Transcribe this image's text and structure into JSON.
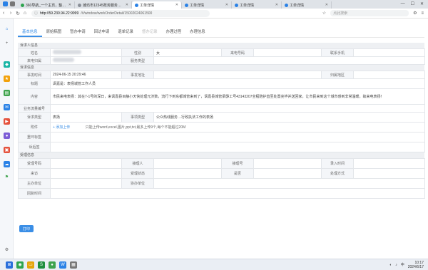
{
  "browser": {
    "tabs": [
      {
        "title": "360导航_一个主页，整个世",
        "active": false,
        "icon": "green"
      },
      {
        "title": "潍坊市12345政务服务便民热",
        "active": false,
        "icon": "grey"
      },
      {
        "title": "工单详情",
        "active": true,
        "icon": "blue"
      },
      {
        "title": "工单详情",
        "active": false,
        "icon": "blue"
      },
      {
        "title": "工单详情",
        "active": false,
        "icon": "blue"
      },
      {
        "title": "工单详情",
        "active": false,
        "icon": "blue"
      }
    ],
    "url_host": "http://59.230.94.22:9999",
    "url_path": "/#/window/workOrderDetail/15002024061500",
    "search_placeholder": "点此搜索"
  },
  "content_tabs": [
    {
      "label": "基本信息",
      "active": true
    },
    {
      "label": "原始稿图",
      "active": false
    },
    {
      "label": "暂办申请",
      "active": false
    },
    {
      "label": "回访申请",
      "active": false
    },
    {
      "label": "退单记录",
      "active": false
    },
    {
      "label": "督办记录",
      "active": false,
      "dim": true
    },
    {
      "label": "办理过程",
      "active": false
    },
    {
      "label": "办理信息",
      "active": false
    }
  ],
  "sections": {
    "caller": "诉求人信息",
    "complaint": "诉求信息",
    "handling": "受理信息"
  },
  "caller_fields": {
    "name_label": "姓名",
    "gender_label": "性别",
    "gender_value": "女",
    "phone_label": "来电号码",
    "contact_label": "联系手机",
    "caller_area_label": "来电归属",
    "service_label": "服务类型"
  },
  "complaint_fields": {
    "time_label": "事发时间",
    "time_value": "2024-06-15 20:29:46",
    "place_label": "事发地址",
    "area_label": "归属地区",
    "title_label": "标题",
    "title_value": "讽嘉是：表扬城管工作人员",
    "content_label": "内容",
    "content_value": "市民来电表扬：其在7-1号的深日，来讽嘉县目静小天快处理元济数，流行下到东都城管来到了，讽嘉县城管梁霹工号43143207全程陪护直至处置完毕并送回家，让市民来到这个城市感到非常温暖，故来电表扬！",
    "business_no_label": "业务流量编号",
    "category_label": "诉求类型",
    "category_value": "表扬",
    "item_label": "事项类型",
    "item_value": "公众热线服务→行政执法工作的表扬",
    "attachment_label": "附件",
    "upload_label": "+ 添加上传",
    "upload_hint": "只能上传word,excel,图片,ppt,txt,最多上传9个,每个不能超过20M",
    "point_label": "重环标签",
    "remark_label": "诉后签"
  },
  "handling_fields": {
    "receiver_label": "受理号码",
    "receiver_name_label": "接理人",
    "work_no_label": "接理号",
    "recorder_label": "录入时间",
    "type_label": "来访",
    "dept_label": "受理状态",
    "status_label": "是否",
    "method_label": "处理方式",
    "undertake_label": "主办单位",
    "assist_label": "协办单位",
    "reply_label": "回复时间"
  },
  "submit_label": "打印",
  "taskbar": {
    "time": "10:17",
    "date": "2024/6/17",
    "lang": "中"
  }
}
